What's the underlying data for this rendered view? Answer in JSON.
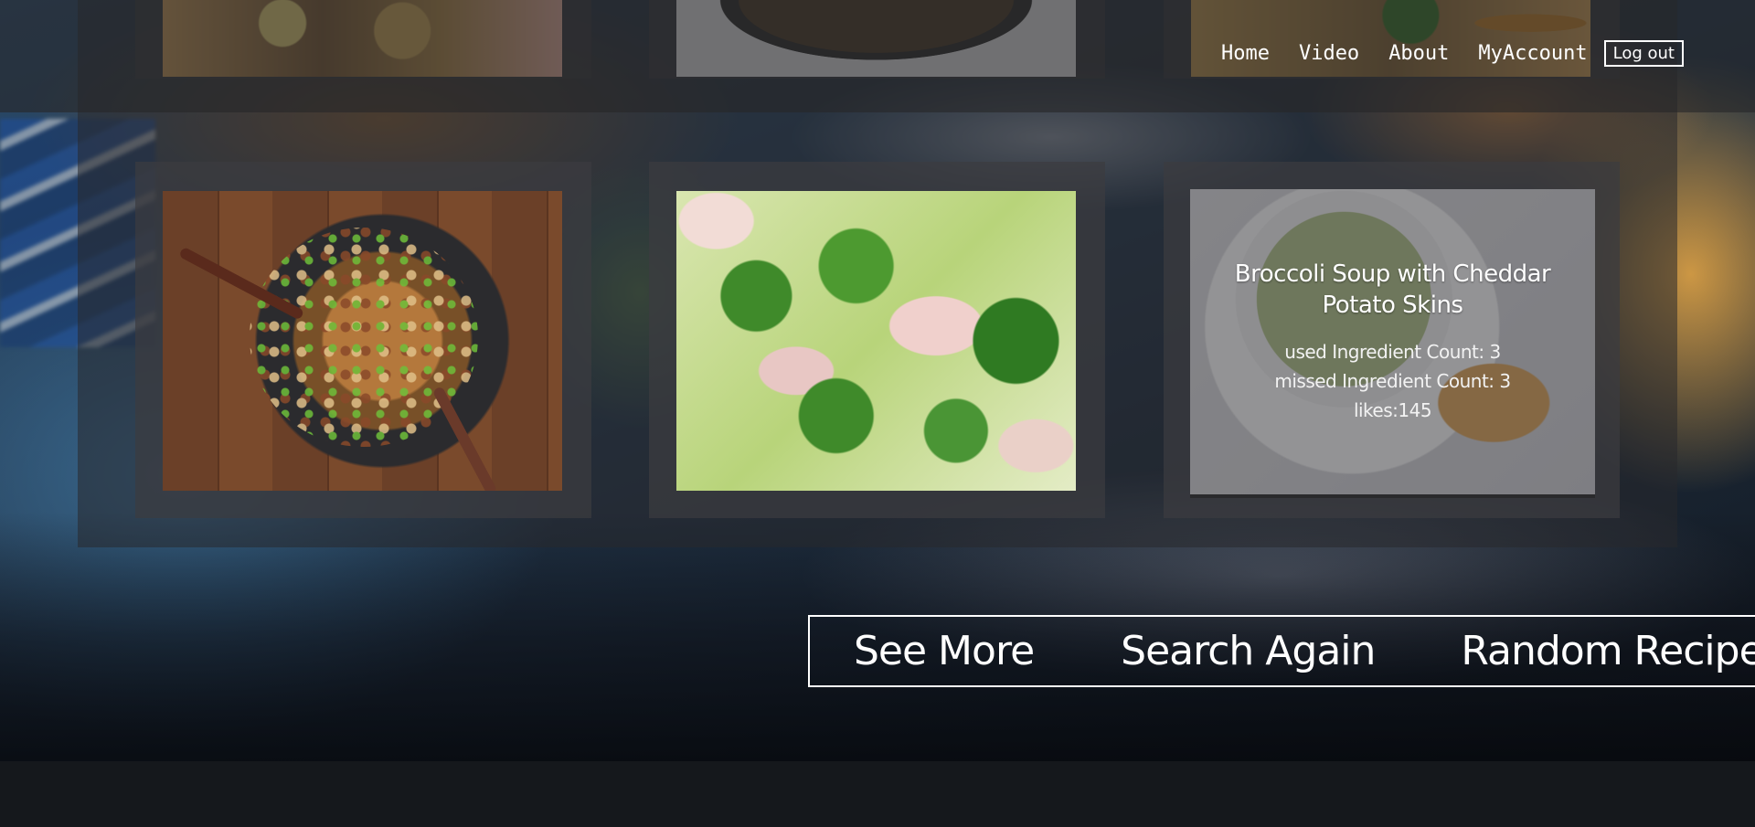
{
  "nav": {
    "links": [
      "Home",
      "Video",
      "About",
      "MyAccount"
    ],
    "logout_label": "Log out"
  },
  "recipes": [
    {
      "title": "Broccoli Soup with Cheddar Potato Skins",
      "used_ingredients": "used Ingredient Count: 3",
      "missed_ingredients": "missed Ingredient Count: 3",
      "likes": "likes:145"
    }
  ],
  "actions": {
    "see_more": "See More",
    "search_again": "Search Again",
    "random_recipe": "Random Recipe"
  },
  "colors": {
    "text": "#ffffff",
    "panel": "#28282c",
    "card": "#3c3c40"
  }
}
